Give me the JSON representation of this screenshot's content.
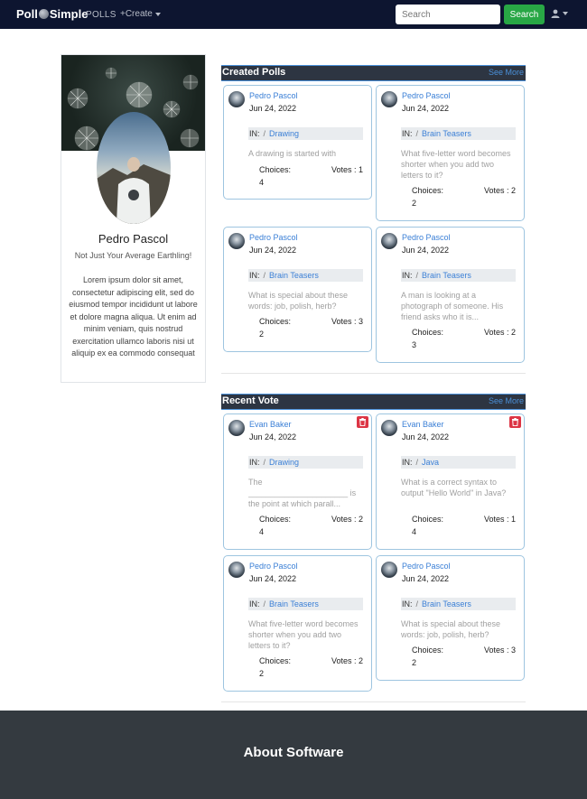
{
  "navbar": {
    "brand_left": "Poll",
    "brand_right": "Simple",
    "polls_label": "POLLS",
    "create_label": "+Create",
    "search_placeholder": "Search",
    "search_button": "Search"
  },
  "profile": {
    "name": "Pedro Pascol",
    "tagline": "Not Just Your Average Earthling!",
    "bio": "Lorem ipsum dolor sit amet, consectetur adipiscing elit, sed do eiusmod tempor incididunt ut labore et dolore magna aliqua. Ut enim ad minim veniam, quis nostrud exercitation ullamco laboris nisi ut aliquip ex ea commodo consequat"
  },
  "created_polls": {
    "title": "Created Polls",
    "see_more": "See More",
    "cards": [
      {
        "author": "Pedro Pascol",
        "date": "Jun 24, 2022",
        "in_label": "IN:",
        "sep": "/",
        "category": "Drawing",
        "question": "A drawing is started with",
        "choices_label": "Choices:",
        "choices": "4",
        "votes": "Votes : 1"
      },
      {
        "author": "Pedro Pascol",
        "date": "Jun 24, 2022",
        "in_label": "IN:",
        "sep": "/",
        "category": "Brain Teasers",
        "question": "What five-letter word becomes shorter when you add two letters to it?",
        "choices_label": "Choices:",
        "choices": "2",
        "votes": "Votes : 2"
      },
      {
        "author": "Pedro Pascol",
        "date": "Jun 24, 2022",
        "in_label": "IN:",
        "sep": "/",
        "category": "Brain Teasers",
        "question": "What is special about these words: job, polish, herb?",
        "choices_label": "Choices:",
        "choices": "2",
        "votes": "Votes : 3"
      },
      {
        "author": "Pedro Pascol",
        "date": "Jun 24, 2022",
        "in_label": "IN:",
        "sep": "/",
        "category": "Brain Teasers",
        "question": "A man is looking at a photograph of someone. His friend asks who it is...",
        "choices_label": "Choices:",
        "choices": "3",
        "votes": "Votes : 2"
      }
    ]
  },
  "recent_vote": {
    "title": "Recent Vote",
    "see_more": "See More",
    "cards": [
      {
        "author": "Evan Baker",
        "date": "Jun 24, 2022",
        "in_label": "IN:",
        "sep": "/",
        "category": "Drawing",
        "question": "The ______________________ is the point at which parall...",
        "choices_label": "Choices:",
        "choices": "4",
        "votes": "Votes : 2"
      },
      {
        "author": "Evan Baker",
        "date": "Jun 24, 2022",
        "in_label": "IN:",
        "sep": "/",
        "category": "Java",
        "question": "What is a correct syntax to output \"Hello World\" in Java?",
        "choices_label": "Choices:",
        "choices": "4",
        "votes": "Votes : 1"
      },
      {
        "author": "Pedro Pascol",
        "date": "Jun 24, 2022",
        "in_label": "IN:",
        "sep": "/",
        "category": "Brain Teasers",
        "question": "What five-letter word becomes shorter when you add two letters to it?",
        "choices_label": "Choices:",
        "choices": "2",
        "votes": "Votes : 2"
      },
      {
        "author": "Pedro Pascol",
        "date": "Jun 24, 2022",
        "in_label": "IN:",
        "sep": "/",
        "category": "Brain Teasers",
        "question": "What is special about these words: job, polish, herb?",
        "choices_label": "Choices:",
        "choices": "2",
        "votes": "Votes : 3"
      }
    ]
  },
  "footer": {
    "title": "About Software"
  },
  "icons": {
    "user": "user-icon",
    "trash": "trash-icon",
    "caret": "caret-down-icon"
  },
  "colors": {
    "navbar": "#0d1530",
    "search_button": "#28a745",
    "link": "#3a7fd6",
    "section_header": "#2d3542",
    "card_border": "#9ec5e0",
    "trash": "#dc3545",
    "footer": "#343a40"
  }
}
